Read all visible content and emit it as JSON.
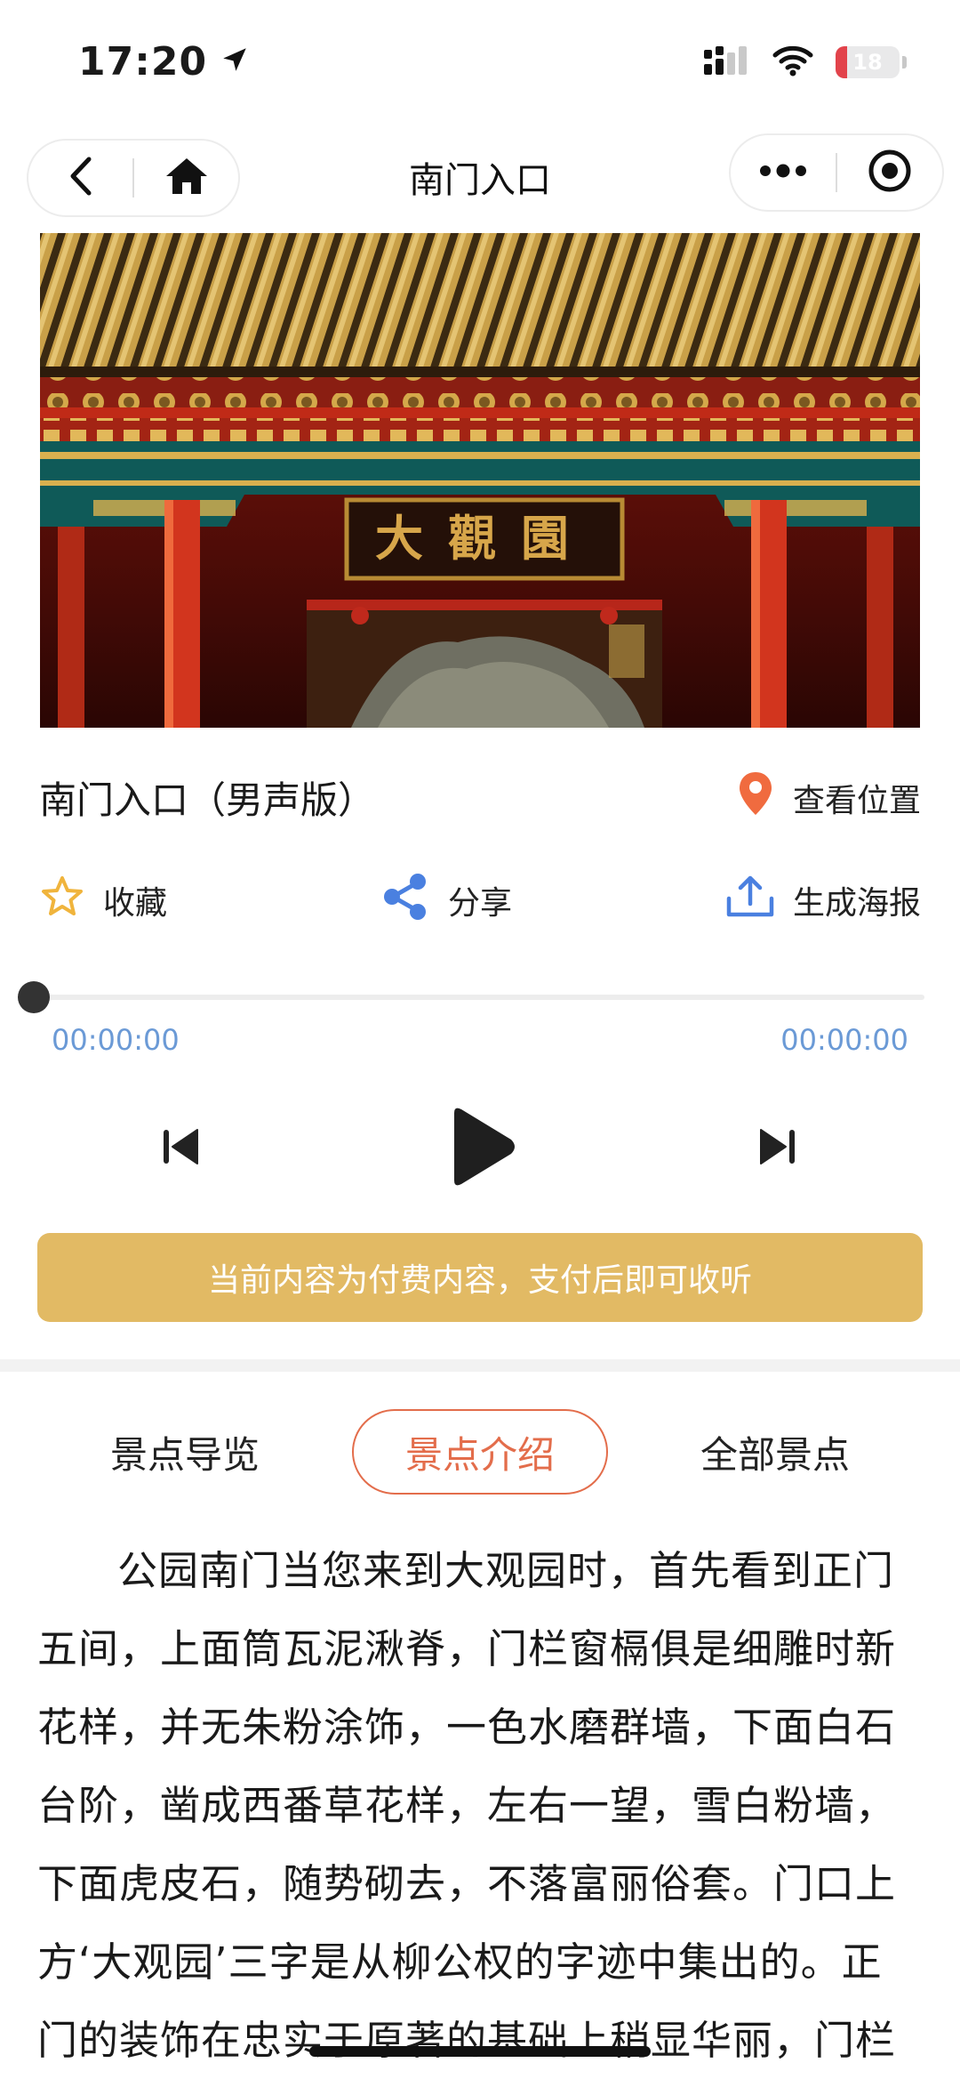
{
  "status_bar": {
    "time": "17:20",
    "battery_level": "18",
    "battery_fraction": 0.18,
    "icons": [
      "location-arrow-icon",
      "signal-icon",
      "wifi-icon",
      "battery-icon"
    ]
  },
  "nav": {
    "title": "南门入口",
    "left_icons": [
      "back-icon",
      "home-icon"
    ],
    "right_icons": [
      "more-icon",
      "close-miniprogram-icon"
    ]
  },
  "hero": {
    "plaque_text": "大觀園",
    "colors": {
      "roof": "#b8923a",
      "pillar": "#d2351e",
      "beam": "#0f5a58"
    }
  },
  "track": {
    "title": "南门入口（男声版）",
    "location_label": "查看位置",
    "location_icon": "map-pin-icon",
    "location_color": "#f06b3f"
  },
  "actions": [
    {
      "label": "收藏",
      "icon": "star-icon",
      "color": "#f0b43c"
    },
    {
      "label": "分享",
      "icon": "share-icon",
      "color": "#4a80e0"
    },
    {
      "label": "生成海报",
      "icon": "upload-icon",
      "color": "#4a80e0"
    }
  ],
  "player": {
    "current_time": "00:00:00",
    "total_time": "00:00:00",
    "progress": 0,
    "controls": [
      "previous-icon",
      "play-icon",
      "next-icon"
    ]
  },
  "pay_banner": {
    "text": "当前内容为付费内容，支付后即可收听",
    "color": "#e2ba64"
  },
  "tabs": [
    {
      "label": "景点导览",
      "active": false
    },
    {
      "label": "景点介绍",
      "active": true
    },
    {
      "label": "全部景点",
      "active": false
    }
  ],
  "article": {
    "text": "公园南门当您来到大观园时，首先看到正门五间，上面筒瓦泥湫脊，门栏窗槅俱是细雕时新花样，并无朱粉涂饰，一色水磨群墙，下面白石台阶，凿成西番草花样，左右一望，雪白粉墙，下面虎皮石，随势砌去，不落富丽俗套。门口上方‘大观园’三字是从柳公权的字迹中集出的。正门的装饰在忠实于原著的基础上稍显华丽，门栏窗槅都用了朱"
  },
  "theme": {
    "accent": "#e36d4b",
    "time_color": "#6b9ad6"
  }
}
